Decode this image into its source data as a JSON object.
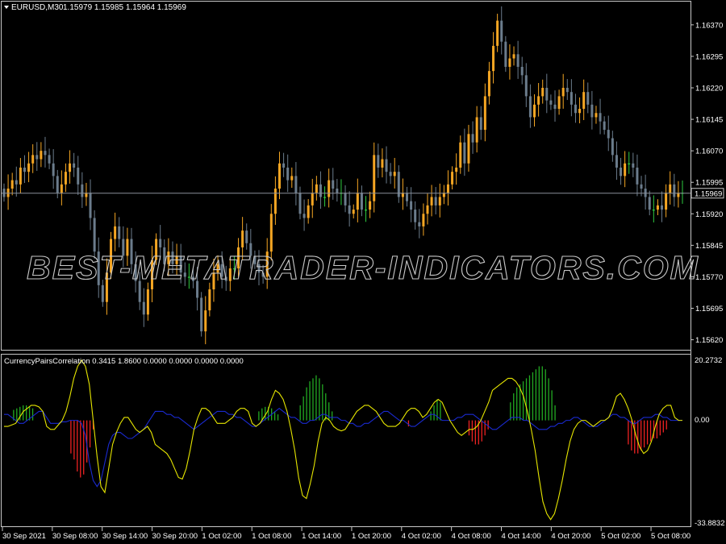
{
  "main": {
    "symbol_label": "EURUSD,M30",
    "ohlc_label": "1.15979 1.15985 1.15964 1.15969",
    "current_price": "1.15969",
    "current_value": 1.15969,
    "price_range": [
      1.156,
      1.1641
    ],
    "price_axis_labels": [
      "1.16370",
      "1.16295",
      "1.16220",
      "1.16145",
      "1.16070",
      "1.15995",
      "1.15920",
      "1.15845",
      "1.15770",
      "1.15695",
      "1.15620"
    ],
    "watermark": "BEST-METATRADER-INDICATORS.COM",
    "colors": {
      "bull": "#f5a623",
      "bear": "#6b7c8c",
      "doji": "#2ecc40",
      "grid": "#c8c8c8",
      "price_line": "#8a8f9a"
    },
    "closes": [
      1.1596,
      1.1598,
      1.16,
      1.1599,
      1.1603,
      1.1602,
      1.1604,
      1.1606,
      1.1605,
      1.1607,
      1.1606,
      1.1604,
      1.1601,
      1.1597,
      1.1599,
      1.1602,
      1.1604,
      1.1603,
      1.1599,
      1.1596,
      1.1597,
      1.1591,
      1.1583,
      1.1575,
      1.1571,
      1.1578,
      1.1586,
      1.1589,
      1.1586,
      1.1582,
      1.1586,
      1.158,
      1.1576,
      1.1571,
      1.1568,
      1.1574,
      1.1581,
      1.1586,
      1.1584,
      1.158,
      1.1583,
      1.158,
      1.1582,
      1.1578,
      1.1577,
      1.1577,
      1.1576,
      1.1572,
      1.1564,
      1.1569,
      1.1574,
      1.1578,
      1.158,
      1.1577,
      1.1576,
      1.1579,
      1.1579,
      1.1584,
      1.1588,
      1.1585,
      1.1582,
      1.158,
      1.1578,
      1.1577,
      1.1583,
      1.1592,
      1.1598,
      1.1604,
      1.1603,
      1.16,
      1.1601,
      1.1597,
      1.1592,
      1.1591,
      1.1594,
      1.1597,
      1.1599,
      1.1596,
      1.1596,
      1.16,
      1.1598,
      1.1597,
      1.1597,
      1.1594,
      1.1592,
      1.1593,
      1.1597,
      1.1593,
      1.1593,
      1.1595,
      1.1606,
      1.1603,
      1.1605,
      1.1602,
      1.1601,
      1.1602,
      1.1596,
      1.1597,
      1.1595,
      1.1593,
      1.159,
      1.1589,
      1.1592,
      1.1594,
      1.1596,
      1.1594,
      1.1596,
      1.1597,
      1.1599,
      1.1602,
      1.1603,
      1.1609,
      1.1604,
      1.1611,
      1.1609,
      1.1615,
      1.1612,
      1.162,
      1.1626,
      1.1632,
      1.1638,
      1.1633,
      1.1627,
      1.1629,
      1.163,
      1.1627,
      1.1625,
      1.162,
      1.1615,
      1.1618,
      1.162,
      1.1622,
      1.1619,
      1.1618,
      1.1617,
      1.162,
      1.1622,
      1.1621,
      1.1618,
      1.1616,
      1.1617,
      1.1621,
      1.1618,
      1.1615,
      1.1616,
      1.1614,
      1.1612,
      1.161,
      1.1606,
      1.1603,
      1.1601,
      1.1604,
      1.1604,
      1.1603,
      1.1599,
      1.1598,
      1.1596,
      1.1593,
      1.1593,
      1.1594,
      1.1593,
      1.1597,
      1.1599,
      1.1596,
      1.1597,
      1.1597
    ]
  },
  "indicator": {
    "label": "CurrencyPairsCorrelation 0.3415 1.8600 0.0000 0.0000 0.0000 0.0000",
    "top_label": "20.2732",
    "zero_label": "0.00",
    "bottom_label": "-33.8832",
    "range": [
      -33.8832,
      20.2732
    ],
    "colors": {
      "positive": "#22aa22",
      "negative": "#ee2222",
      "main_line": "#e6e600",
      "signal_line": "#1a2ad0"
    },
    "main_values": [
      -2,
      -2,
      -1.5,
      -1,
      1,
      3,
      4,
      5,
      5,
      4.5,
      3,
      -2,
      -3,
      -3,
      -1.5,
      0,
      3,
      8,
      14,
      18,
      20,
      18,
      12,
      0,
      -12,
      -22,
      -24,
      -16,
      -8,
      -4,
      -1,
      1,
      1,
      -1,
      -3,
      -4,
      -3,
      -2,
      -4,
      -8,
      -9,
      -10,
      -11,
      -13,
      -16,
      -19,
      -19.5,
      -16,
      -10,
      -3,
      1,
      4,
      4,
      3,
      1,
      -1,
      -1,
      -1,
      0,
      1,
      3,
      4,
      4,
      3,
      -1,
      -2,
      -1,
      1,
      3,
      7,
      10,
      9,
      7,
      3,
      -3,
      -10,
      -19,
      -25,
      -26,
      -21,
      -15,
      -7,
      -1,
      1,
      0,
      -2,
      -3,
      -3.5,
      -3,
      -1,
      1,
      3,
      4,
      5,
      5,
      4,
      3,
      1,
      -1,
      -2,
      -2,
      -2,
      -1,
      1,
      3,
      4,
      4,
      3,
      1,
      2,
      4,
      6,
      7,
      6,
      3,
      0,
      -2,
      -4,
      -5,
      -4,
      -3,
      -3,
      -2,
      0,
      3,
      6,
      10,
      11,
      12,
      13,
      14,
      14,
      13,
      11,
      8,
      3,
      -3,
      -10,
      -19,
      -27,
      -31,
      -33,
      -31,
      -26,
      -20,
      -13,
      -7,
      -3,
      -1,
      0,
      0,
      -1,
      -2,
      -1,
      0,
      0,
      1,
      4,
      8,
      9,
      7,
      4,
      0,
      -5,
      -9,
      -11,
      -10,
      -7,
      -2,
      2,
      4,
      5,
      5,
      1,
      0,
      0
    ],
    "bar_values": [
      0,
      0,
      0,
      3.5,
      4,
      4.5,
      5,
      5,
      4.5,
      4,
      0,
      0,
      0,
      0,
      0,
      0,
      0,
      0,
      0,
      0,
      0,
      -11,
      -13,
      -17,
      -19,
      -18,
      -14,
      -9,
      -3,
      0,
      0,
      0,
      0,
      0,
      0,
      0,
      0,
      0,
      0,
      0,
      0,
      0,
      0,
      0,
      0,
      0,
      0,
      0,
      0,
      0,
      0,
      0,
      0,
      0,
      0,
      0,
      0,
      0,
      0,
      0,
      0,
      0,
      0,
      0,
      0,
      0,
      0,
      0,
      0,
      0,
      0,
      0,
      0,
      0,
      0,
      0,
      0,
      0,
      0,
      0,
      3,
      4,
      4.5,
      4.5,
      4,
      3,
      2,
      0,
      0,
      0,
      0,
      0,
      0,
      5,
      8,
      11,
      13,
      14,
      15,
      14,
      12,
      9,
      6,
      3,
      0,
      0,
      0,
      0,
      0,
      0,
      0,
      0,
      0,
      0,
      0,
      0,
      0,
      0,
      0,
      0,
      0,
      0,
      0,
      0,
      0,
      0,
      0,
      -2,
      0,
      0,
      0,
      0,
      0,
      0,
      3,
      5,
      7,
      6,
      0,
      0,
      0,
      0,
      0,
      0,
      0,
      0,
      -5,
      -7,
      -8,
      -8,
      -7,
      -5,
      -3,
      0,
      0,
      0,
      0,
      0,
      0,
      6,
      9,
      11,
      12,
      13,
      14,
      15,
      16,
      17,
      18,
      18,
      17,
      14,
      10,
      5,
      0,
      0,
      0,
      0,
      0,
      0,
      0,
      0,
      0,
      0,
      0,
      0,
      0,
      0,
      0,
      0,
      0,
      0,
      0,
      0,
      0,
      0,
      -8,
      -10,
      -11,
      -11,
      -10,
      -9,
      -8,
      -7,
      -6,
      -6,
      -5,
      -4,
      -3,
      0,
      0,
      0,
      0,
      0
    ],
    "signal_values": [
      2,
      2,
      1,
      0,
      -1,
      -1,
      0,
      1,
      2,
      3,
      3,
      1,
      -1,
      -1,
      -1,
      -0.5,
      -0.5,
      0,
      0,
      0,
      -1,
      -5,
      -14,
      -20,
      -22,
      -20,
      -14,
      -8,
      -5,
      -4,
      -4,
      -5,
      -6,
      -6,
      -5,
      -4,
      -3,
      -1,
      1,
      3,
      3,
      3,
      2,
      2,
      1,
      1,
      0,
      -1,
      -2,
      -3,
      -2,
      -1,
      0,
      1,
      2,
      3,
      3,
      3,
      2,
      2,
      1,
      1,
      0,
      -1,
      -2,
      -2,
      -1,
      0,
      1,
      2,
      3,
      4,
      3,
      2,
      1,
      1,
      0,
      -1,
      -1,
      0,
      0,
      1,
      2,
      2,
      1,
      1,
      1,
      0,
      0,
      -1,
      -1,
      -2,
      -2,
      -1,
      -1,
      0,
      1,
      2,
      3,
      3,
      2,
      1,
      0,
      0,
      -1,
      -2,
      -2,
      -1,
      0,
      1,
      2,
      2,
      1,
      0,
      0,
      0,
      0,
      1,
      1,
      2,
      2,
      2,
      1,
      0,
      -1,
      -2,
      -3,
      -3,
      -2,
      -1,
      0,
      1,
      1,
      1,
      0,
      0,
      -1,
      -2,
      -3,
      -3,
      -3,
      -2,
      -2,
      -1,
      -1,
      0,
      0,
      1,
      1,
      0,
      -1,
      -2,
      -2,
      -2,
      -1,
      0,
      1,
      2,
      2,
      1,
      1,
      0,
      -1,
      -1,
      0,
      1,
      1,
      1,
      2,
      2,
      1,
      1,
      0,
      0,
      0,
      0
    ]
  },
  "time_axis_labels": [
    "30 Sep 2021",
    "30 Sep 08:00",
    "30 Sep 14:00",
    "30 Sep 20:00",
    "1 Oct 02:00",
    "1 Oct 08:00",
    "1 Oct 14:00",
    "1 Oct 20:00",
    "4 Oct 02:00",
    "4 Oct 08:00",
    "4 Oct 14:00",
    "4 Oct 20:00",
    "5 Oct 02:00",
    "5 Oct 08:00"
  ]
}
